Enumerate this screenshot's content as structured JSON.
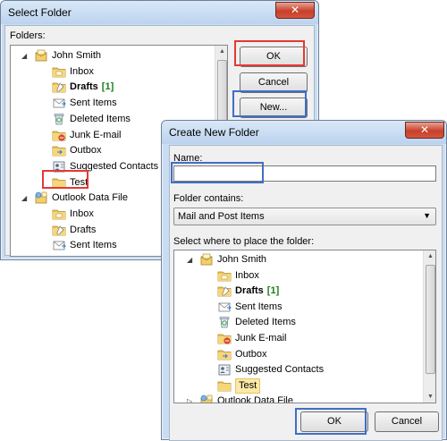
{
  "select_folder": {
    "title": "Select Folder",
    "close_glyph": "✕",
    "folders_label": "Folders:",
    "ok_label": "OK",
    "cancel_label": "Cancel",
    "new_label": "New...",
    "tree": [
      {
        "label": "John Smith",
        "icon": "mailbox-icon",
        "level": 0,
        "expander": "◢"
      },
      {
        "label": "Inbox",
        "icon": "inbox-folder-icon",
        "level": 1
      },
      {
        "label": "Drafts",
        "count": "[1]",
        "icon": "drafts-folder-icon",
        "level": 1,
        "bold": true
      },
      {
        "label": "Sent Items",
        "icon": "sent-items-folder-icon",
        "level": 1
      },
      {
        "label": "Deleted Items",
        "icon": "deleted-items-folder-icon",
        "level": 1
      },
      {
        "label": "Junk E-mail",
        "icon": "junk-folder-icon",
        "level": 1
      },
      {
        "label": "Outbox",
        "icon": "outbox-folder-icon",
        "level": 1
      },
      {
        "label": "Suggested Contacts",
        "icon": "contacts-folder-icon",
        "level": 1
      },
      {
        "label": "Test",
        "icon": "folder-icon",
        "level": 1
      },
      {
        "label": "Outlook Data File",
        "icon": "data-file-icon",
        "level": 0,
        "expander": "◢"
      },
      {
        "label": "Inbox",
        "icon": "inbox-folder-icon",
        "level": 1
      },
      {
        "label": "Drafts",
        "icon": "drafts-folder-icon",
        "level": 1
      },
      {
        "label": "Sent Items",
        "icon": "sent-items-folder-icon",
        "level": 1
      }
    ]
  },
  "create_folder": {
    "title": "Create New Folder",
    "close_glyph": "✕",
    "name_label": "Name:",
    "name_value": "",
    "contains_label": "Folder contains:",
    "contains_value": "Mail and Post Items",
    "place_label": "Select where to place the folder:",
    "ok_label": "OK",
    "cancel_label": "Cancel",
    "tree": [
      {
        "label": "John Smith",
        "icon": "mailbox-icon",
        "level": 0,
        "expander": "◢"
      },
      {
        "label": "Inbox",
        "icon": "inbox-folder-icon",
        "level": 1
      },
      {
        "label": "Drafts",
        "count": "[1]",
        "icon": "drafts-folder-icon",
        "level": 1,
        "bold": true
      },
      {
        "label": "Sent Items",
        "icon": "sent-items-folder-icon",
        "level": 1
      },
      {
        "label": "Deleted Items",
        "icon": "deleted-items-folder-icon",
        "level": 1
      },
      {
        "label": "Junk E-mail",
        "icon": "junk-folder-icon",
        "level": 1
      },
      {
        "label": "Outbox",
        "icon": "outbox-folder-icon",
        "level": 1
      },
      {
        "label": "Suggested Contacts",
        "icon": "contacts-folder-icon",
        "level": 1
      },
      {
        "label": "Test",
        "icon": "folder-icon",
        "level": 1,
        "selected": true
      },
      {
        "label": "Outlook Data File",
        "icon": "data-file-icon",
        "level": 0,
        "expander": "▷"
      }
    ]
  },
  "colors": {
    "highlight_red": "#e53935",
    "highlight_blue": "#3f6fc6",
    "selection": "#fbe9a8",
    "count_green": "#1a7f1a"
  }
}
